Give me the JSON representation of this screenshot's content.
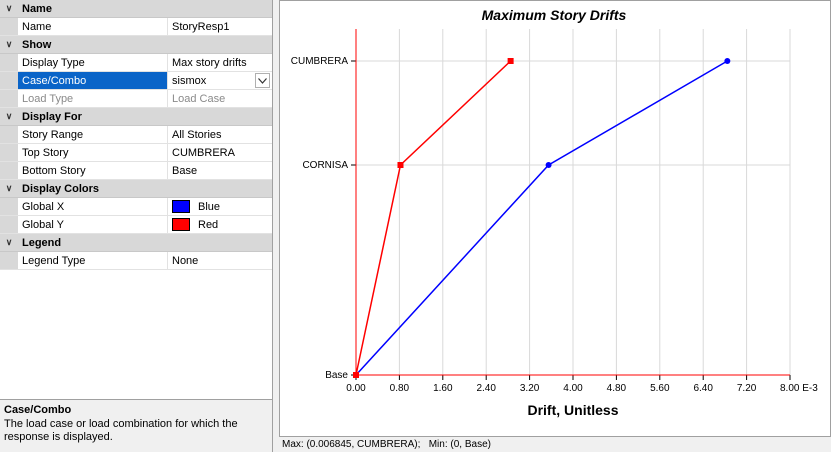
{
  "properties": {
    "cat_name": "Name",
    "name_label": "Name",
    "name_value": "StoryResp1",
    "cat_show": "Show",
    "display_type_label": "Display Type",
    "display_type_value": "Max story drifts",
    "case_label": "Case/Combo",
    "case_value": "sismox",
    "load_type_label": "Load Type",
    "load_type_value": "Load Case",
    "cat_display_for": "Display For",
    "story_range_label": "Story Range",
    "story_range_value": "All Stories",
    "top_story_label": "Top Story",
    "top_story_value": "CUMBRERA",
    "bottom_story_label": "Bottom Story",
    "bottom_story_value": "Base",
    "cat_display_colors": "Display Colors",
    "global_x_label": "Global X",
    "global_x_value": "Blue",
    "global_x_color": "#0000ff",
    "global_y_label": "Global Y",
    "global_y_value": "Red",
    "global_y_color": "#ff0000",
    "cat_legend": "Legend",
    "legend_type_label": "Legend Type",
    "legend_type_value": "None"
  },
  "description": {
    "title": "Case/Combo",
    "text": "The load case or load combination for which the response is displayed."
  },
  "status": {
    "text": "Max: (0.006845, CUMBRERA);   Min: (0, Base)"
  },
  "chart_data": {
    "type": "line",
    "title": "Maximum Story Drifts",
    "xlabel": "Drift, Unitless",
    "x_tick_labels": [
      "0.00",
      "0.80",
      "1.60",
      "2.40",
      "3.20",
      "4.00",
      "4.80",
      "5.60",
      "6.40",
      "7.20",
      "8.00 E-3"
    ],
    "xlim": [
      0,
      8.0
    ],
    "x_unit_multiplier": "E-3",
    "categories": [
      "Base",
      "CORNISA",
      "CUMBRERA"
    ],
    "series": [
      {
        "name": "Global X",
        "color": "#0000ff",
        "values": [
          0,
          3.55,
          6.845
        ],
        "marker": "circle"
      },
      {
        "name": "Global Y",
        "color": "#ff0000",
        "values": [
          0,
          0.82,
          2.85
        ],
        "marker": "square"
      }
    ],
    "grid": true,
    "icon_names": [
      "chevron-down-icon",
      "dropdown-arrow-icon"
    ]
  }
}
